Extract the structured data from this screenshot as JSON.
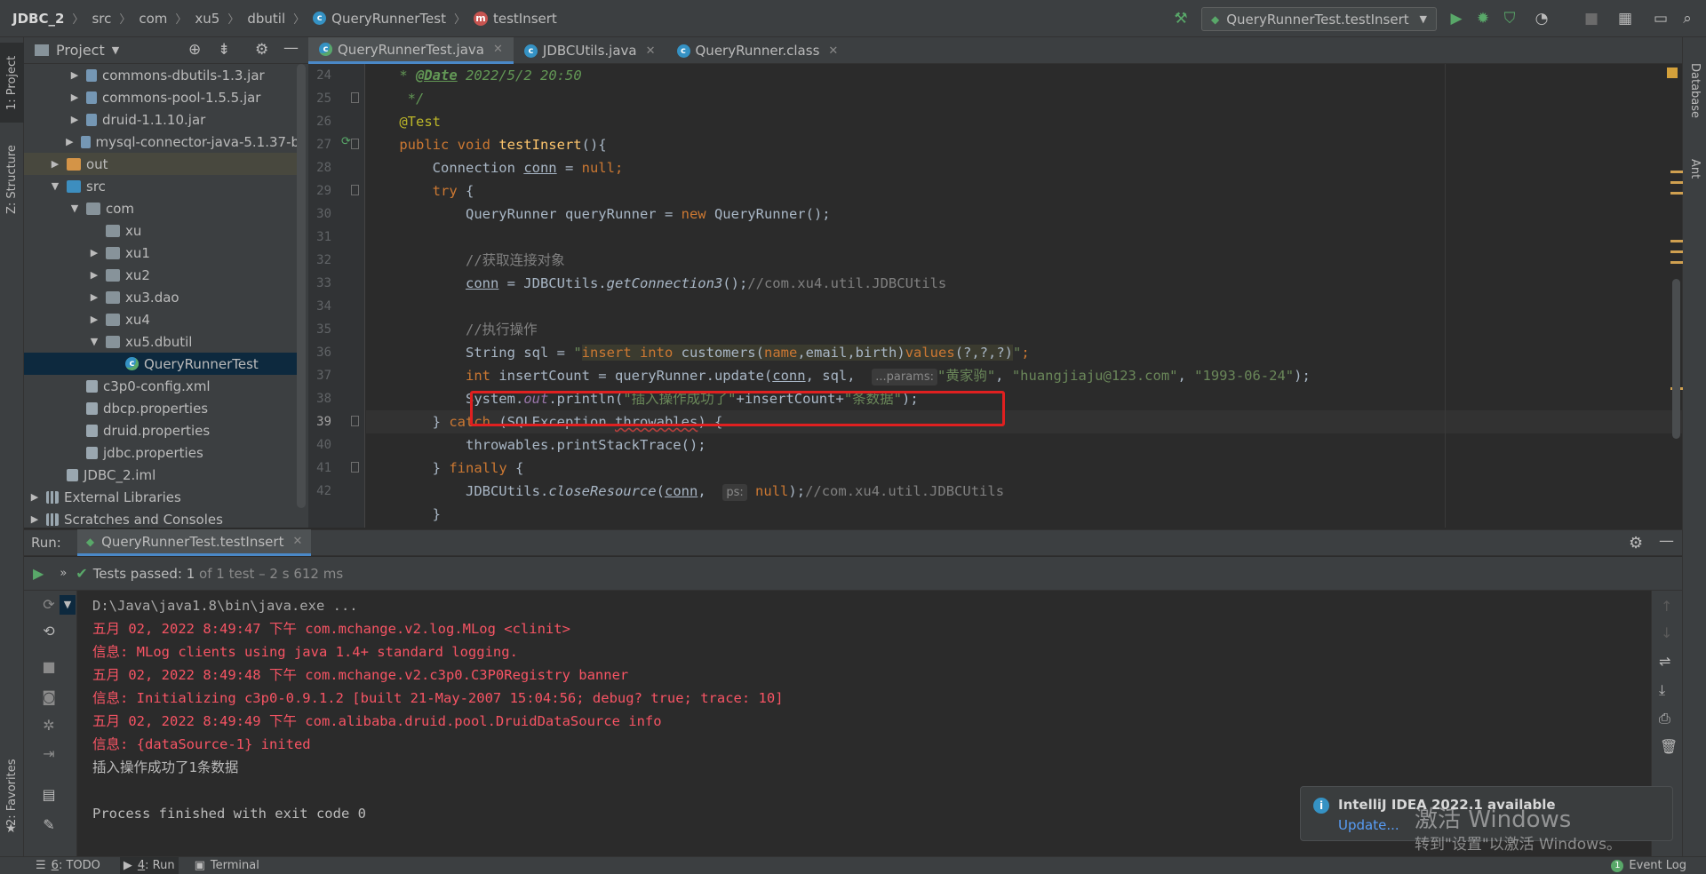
{
  "navbar": {
    "crumbs": [
      "JDBC_2",
      "src",
      "com",
      "xu5",
      "dbutil",
      "QueryRunnerTest",
      "testInsert"
    ],
    "run_config": "QueryRunnerTest.testInsert"
  },
  "left_stripe": {
    "project": "1: Project",
    "structure": "Z: Structure",
    "favorites": "2: Favorites"
  },
  "right_stripe": {
    "database": "Database",
    "ant": "Ant"
  },
  "project_panel": {
    "title": "Project",
    "items": [
      {
        "label": "commons-dbutils-1.3.jar",
        "type": "jar",
        "indent": 2,
        "expand": "closed"
      },
      {
        "label": "commons-pool-1.5.5.jar",
        "type": "jar",
        "indent": 2,
        "expand": "closed"
      },
      {
        "label": "druid-1.1.10.jar",
        "type": "jar",
        "indent": 2,
        "expand": "closed"
      },
      {
        "label": "mysql-connector-java-5.1.37-b",
        "type": "jar",
        "indent": 2,
        "expand": "closed"
      },
      {
        "label": "out",
        "type": "folder-o",
        "indent": 1,
        "expand": "closed"
      },
      {
        "label": "src",
        "type": "folder-b",
        "indent": 1,
        "expand": "open"
      },
      {
        "label": "com",
        "type": "pkg",
        "indent": 2,
        "expand": "open"
      },
      {
        "label": "xu",
        "type": "pkg",
        "indent": 3,
        "expand": "none"
      },
      {
        "label": "xu1",
        "type": "pkg",
        "indent": 3,
        "expand": "closed"
      },
      {
        "label": "xu2",
        "type": "pkg",
        "indent": 3,
        "expand": "closed"
      },
      {
        "label": "xu3.dao",
        "type": "pkg",
        "indent": 3,
        "expand": "closed"
      },
      {
        "label": "xu4",
        "type": "pkg",
        "indent": 3,
        "expand": "closed"
      },
      {
        "label": "xu5.dbutil",
        "type": "pkg",
        "indent": 3,
        "expand": "open"
      },
      {
        "label": "QueryRunnerTest",
        "type": "class",
        "indent": 4,
        "expand": "none"
      },
      {
        "label": "c3p0-config.xml",
        "type": "file",
        "indent": 2,
        "expand": "none"
      },
      {
        "label": "dbcp.properties",
        "type": "file",
        "indent": 2,
        "expand": "none"
      },
      {
        "label": "druid.properties",
        "type": "file",
        "indent": 2,
        "expand": "none"
      },
      {
        "label": "jdbc.properties",
        "type": "file",
        "indent": 2,
        "expand": "none"
      },
      {
        "label": "JDBC_2.iml",
        "type": "file",
        "indent": 1,
        "expand": "none"
      },
      {
        "label": "External Libraries",
        "type": "lib",
        "indent": 0,
        "expand": "closed"
      },
      {
        "label": "Scratches and Consoles",
        "type": "lib",
        "indent": 0,
        "expand": "closed"
      }
    ]
  },
  "editor_tabs": [
    {
      "label": "QueryRunnerTest.java",
      "active": true
    },
    {
      "label": "JDBCUtils.java",
      "active": false
    },
    {
      "label": "QueryRunner.class",
      "active": false
    }
  ],
  "editor": {
    "line_numbers": [
      "24",
      "25",
      "26",
      "27",
      "28",
      "29",
      "30",
      "31",
      "32",
      "33",
      "34",
      "35",
      "36",
      "37",
      "38",
      "39",
      "40",
      "41",
      "42"
    ],
    "current_line": "39",
    "code": {
      "l24_tag": "@Date",
      "l24_text": " 2022/5/2 20:50",
      "l25": "*/",
      "l26": "@Test",
      "l27_kw": "public void ",
      "l27_fn": "testInsert",
      "l27_rest": "(){",
      "l28_type": "Connection ",
      "l28_var": "conn",
      "l28_rest": " = ",
      "l28_kw": "null",
      "l28_end": ";",
      "l29_kw": "try",
      "l29_rest": " {",
      "l30_a": "QueryRunner queryRunner = ",
      "l30_kw": "new",
      "l30_b": " QueryRunner();",
      "l32": "//获取连接对象",
      "l33_var": "conn",
      "l33_a": " = JDBCUtils.",
      "l33_m": "getConnection3",
      "l33_b": "();",
      "l33_cm": "//com.xu4.util.JDBCUtils",
      "l35": "//执行操作",
      "l36_a": "String sql = ",
      "l36_q1": "\"",
      "l36_k1": "insert into",
      "l36_id1": " customers",
      "l36_p1": "(",
      "l36_c1": "name",
      "l36_cma1": ",",
      "l36_c2": "email",
      "l36_cma2": ",",
      "l36_c3": "birth",
      "l36_p2": ")",
      "l36_k2": "values",
      "l36_v": "(?,?,?)",
      "l36_q2": "\"",
      "l36_end": ";",
      "l37_kw": "int ",
      "l37_a": "insertCount = queryRunner.update(",
      "l37_var": "conn",
      "l37_b": ", sql,  ",
      "l37_hint": "...params:",
      "l37_s1": "\"黄家驹\"",
      "l37_c1": ", ",
      "l37_s2": "\"huangjiaju@123.com\"",
      "l37_c2": ", ",
      "l37_s3": "\"1993-06-24\"",
      "l37_end": ");",
      "l38_a": "System.",
      "l38_f": "out",
      "l38_b": ".println(",
      "l38_s1": "\"插入操作成功了\"",
      "l38_c": "+insertCount+",
      "l38_s2": "\"条数据\"",
      "l38_end": ");",
      "l39_a": "} ",
      "l39_kw": "catch",
      "l39_b": " (SQLException ",
      "l39_var": "throwables",
      "l39_c": ") {",
      "l40": "throwables.printStackTrace();",
      "l41_a": "} ",
      "l41_kw": "finally",
      "l41_b": " {",
      "l42_a": "JDBCUtils.",
      "l42_m": "closeResource",
      "l42_b": "(",
      "l42_var": "conn",
      "l42_c": ",  ",
      "l42_hint": "ps:",
      "l42_kw": " null",
      "l42_d": ");",
      "l42_cm": "//com.xu4.util.JDBCUtils",
      "l43": "}"
    }
  },
  "run_panel": {
    "label": "Run:",
    "tab": "QueryRunnerTest.testInsert",
    "status_bold": "Tests passed: ",
    "status_count": "1",
    "status_rest": " of 1 test – 2 s 612 ms"
  },
  "console": [
    {
      "text": "D:\\Java\\java1.8\\bin\\java.exe ...",
      "style": "gray"
    },
    {
      "text": "五月 02, 2022 8:49:47 下午 com.mchange.v2.log.MLog <clinit>",
      "style": "red"
    },
    {
      "text": "信息: MLog clients using java 1.4+ standard logging.",
      "style": "red"
    },
    {
      "text": "五月 02, 2022 8:49:48 下午 com.mchange.v2.c3p0.C3P0Registry banner",
      "style": "red"
    },
    {
      "text": "信息: Initializing c3p0-0.9.1.2 [built 21-May-2007 15:04:56; debug? true; trace: 10]",
      "style": "red"
    },
    {
      "text": "五月 02, 2022 8:49:49 下午 com.alibaba.druid.pool.DruidDataSource info",
      "style": "red"
    },
    {
      "text": "信息: {dataSource-1} inited",
      "style": "red"
    },
    {
      "text": "插入操作成功了1条数据",
      "style": "plain"
    },
    {
      "text": "",
      "style": "plain"
    },
    {
      "text": "Process finished with exit code 0",
      "style": "plain"
    }
  ],
  "notification": {
    "title": "IntelliJ IDEA 2022.1 available",
    "link": "Update..."
  },
  "watermark": {
    "line1": "激活 Windows",
    "line2": "转到\"设置\"以激活 Windows。"
  },
  "statusbar": {
    "todo_num": "6",
    "todo": ": TODO",
    "run_num": "4",
    "run": ": Run",
    "terminal": "Terminal",
    "event_count": "1",
    "event_log": "Event Log"
  },
  "colors": {
    "accent": "#4a88c7",
    "highlight_box": "#e02020",
    "passed": "#59a869"
  }
}
